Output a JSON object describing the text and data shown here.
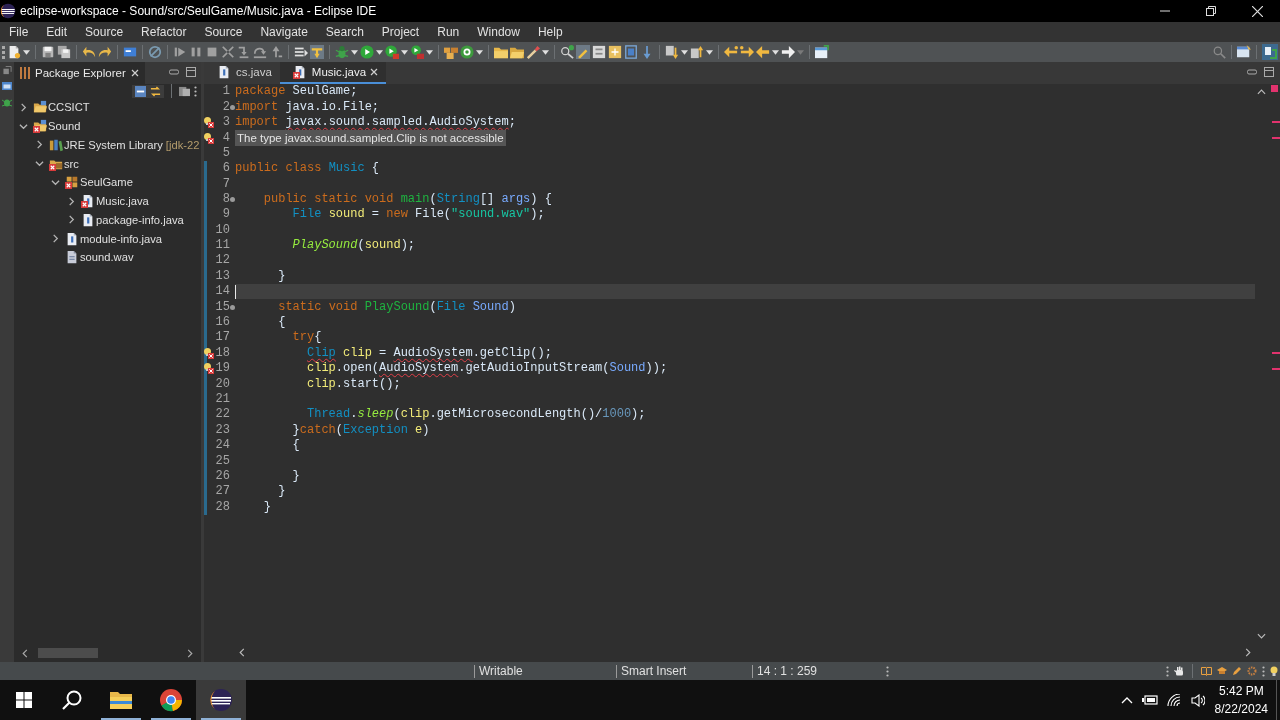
{
  "window": {
    "title": "eclipse-workspace - Sound/src/SeulGame/Music.java - Eclipse IDE"
  },
  "menu": [
    "File",
    "Edit",
    "Source",
    "Refactor",
    "Source",
    "Navigate",
    "Search",
    "Project",
    "Run",
    "Window",
    "Help"
  ],
  "package_explorer": {
    "title": "Package Explorer",
    "tree": [
      {
        "label": "CCSICT",
        "kind": "project",
        "expanded": false,
        "error": false
      },
      {
        "label": "Sound",
        "kind": "project",
        "expanded": true,
        "error": true,
        "children": [
          {
            "label": "JRE System Library",
            "decoration": "[jdk-22",
            "kind": "library",
            "expanded": false,
            "error": false
          },
          {
            "label": "src",
            "kind": "source_folder",
            "expanded": true,
            "error": true,
            "children": [
              {
                "label": "SeulGame",
                "kind": "package",
                "expanded": true,
                "error": true,
                "children": [
                  {
                    "label": "Music.java",
                    "kind": "java_file",
                    "expanded": false,
                    "error": true
                  },
                  {
                    "label": "package-info.java",
                    "kind": "java_file",
                    "expanded": false,
                    "error": false
                  }
                ]
              },
              {
                "label": "module-info.java",
                "kind": "java_file",
                "expanded": false,
                "error": false
              },
              {
                "label": "sound.wav",
                "kind": "file",
                "error": false
              }
            ]
          }
        ]
      }
    ]
  },
  "editor": {
    "tabs": [
      {
        "label": "cs.java",
        "selected": false,
        "error": false
      },
      {
        "label": "Music.java",
        "selected": true,
        "error": true
      }
    ],
    "lines": [
      {
        "number": "1",
        "current": false,
        "scope": false,
        "error": false,
        "foldable": false,
        "tokens": [
          {
            "text": "package",
            "kind": "keyword",
            "error": false
          },
          {
            "text": " SeulGame;",
            "kind": "plain",
            "error": false
          }
        ]
      },
      {
        "number": "2",
        "current": false,
        "scope": false,
        "error": false,
        "foldable": true,
        "tokens": [
          {
            "text": "import",
            "kind": "keyword",
            "error": false
          },
          {
            "text": " java.io.File;",
            "kind": "plain",
            "error": false
          }
        ]
      },
      {
        "number": "3",
        "current": false,
        "scope": false,
        "error": true,
        "foldable": false,
        "tokens": [
          {
            "text": "import ",
            "kind": "keyword",
            "error": false
          },
          {
            "text": "javax.sound.sampled.AudioSystem",
            "kind": "plain",
            "error": true
          },
          {
            "text": ";",
            "kind": "plain",
            "error": false
          }
        ]
      },
      {
        "number": "4",
        "current": false,
        "scope": false,
        "error": true,
        "foldable": false,
        "tooltip": "The type javax.sound.sampled.Clip is not accessible"
      },
      {
        "number": "5",
        "current": false,
        "scope": false,
        "error": false,
        "foldable": false
      },
      {
        "number": "6",
        "current": false,
        "scope": true,
        "error": false,
        "foldable": false,
        "tokens": [
          {
            "text": "public class ",
            "kind": "keyword",
            "error": false
          },
          {
            "text": "Music",
            "kind": "type",
            "error": false
          },
          {
            "text": " {",
            "kind": "plain",
            "error": false
          }
        ]
      },
      {
        "number": "7",
        "current": false,
        "scope": true,
        "error": false,
        "foldable": false
      },
      {
        "number": "8",
        "current": false,
        "scope": true,
        "error": false,
        "foldable": true,
        "tokens": [
          {
            "text": "    public static void ",
            "kind": "keyword",
            "error": false
          },
          {
            "text": "main",
            "kind": "method_declaration",
            "error": false
          },
          {
            "text": "(",
            "kind": "plain",
            "error": false
          },
          {
            "text": "String",
            "kind": "type",
            "error": false
          },
          {
            "text": "[] ",
            "kind": "plain",
            "error": false
          },
          {
            "text": "args",
            "kind": "parameter",
            "error": false
          },
          {
            "text": ") {",
            "kind": "plain",
            "error": false
          }
        ]
      },
      {
        "number": "9",
        "current": false,
        "scope": true,
        "error": false,
        "foldable": false,
        "tokens": [
          {
            "text": "        File ",
            "kind": "type",
            "error": false
          },
          {
            "text": "sound",
            "kind": "local",
            "error": false
          },
          {
            "text": " = ",
            "kind": "plain",
            "error": false
          },
          {
            "text": "new",
            "kind": "keyword",
            "error": false
          },
          {
            "text": " File(",
            "kind": "plain",
            "error": false
          },
          {
            "text": "\"sound.wav\"",
            "kind": "string",
            "error": false
          },
          {
            "text": ");",
            "kind": "plain",
            "error": false
          }
        ]
      },
      {
        "number": "10",
        "current": false,
        "scope": true,
        "error": false,
        "foldable": false
      },
      {
        "number": "11",
        "current": false,
        "scope": true,
        "error": false,
        "foldable": false,
        "tokens": [
          {
            "text": "        PlaySound",
            "kind": "static_call",
            "error": false
          },
          {
            "text": "(",
            "kind": "plain",
            "error": false
          },
          {
            "text": "sound",
            "kind": "local",
            "error": false
          },
          {
            "text": ");",
            "kind": "plain",
            "error": false
          }
        ]
      },
      {
        "number": "12",
        "current": false,
        "scope": true,
        "error": false,
        "foldable": false
      },
      {
        "number": "13",
        "current": false,
        "scope": true,
        "error": false,
        "foldable": false,
        "tokens": [
          {
            "text": "      }",
            "kind": "plain",
            "error": false
          }
        ]
      },
      {
        "number": "14",
        "current": true,
        "scope": true,
        "error": false,
        "foldable": false
      },
      {
        "number": "15",
        "current": false,
        "scope": true,
        "error": false,
        "foldable": true,
        "tokens": [
          {
            "text": "      static void ",
            "kind": "keyword",
            "error": false
          },
          {
            "text": "PlaySound",
            "kind": "method_declaration",
            "error": false
          },
          {
            "text": "(",
            "kind": "plain",
            "error": false
          },
          {
            "text": "File ",
            "kind": "type",
            "error": false
          },
          {
            "text": "Sound",
            "kind": "parameter",
            "error": false
          },
          {
            "text": ")",
            "kind": "plain",
            "error": false
          }
        ]
      },
      {
        "number": "16",
        "current": false,
        "scope": true,
        "error": false,
        "foldable": false,
        "tokens": [
          {
            "text": "      {",
            "kind": "plain",
            "error": false
          }
        ]
      },
      {
        "number": "17",
        "current": false,
        "scope": true,
        "error": false,
        "foldable": false,
        "tokens": [
          {
            "text": "        try",
            "kind": "keyword",
            "error": false
          },
          {
            "text": "{",
            "kind": "plain",
            "error": false
          }
        ]
      },
      {
        "number": "18",
        "current": false,
        "scope": true,
        "error": true,
        "foldable": false,
        "tokens": [
          {
            "text": "          Clip",
            "kind": "type",
            "error": true
          },
          {
            "text": " clip",
            "kind": "local",
            "error": false
          },
          {
            "text": " = ",
            "kind": "plain",
            "error": false
          },
          {
            "text": "AudioSystem",
            "kind": "plain",
            "error": true
          },
          {
            "text": ".getClip();",
            "kind": "plain",
            "error": false
          }
        ]
      },
      {
        "number": "19",
        "current": false,
        "scope": true,
        "error": true,
        "foldable": false,
        "tokens": [
          {
            "text": "          clip",
            "kind": "local",
            "error": false
          },
          {
            "text": ".open(",
            "kind": "plain",
            "error": false
          },
          {
            "text": "AudioSystem",
            "kind": "plain",
            "error": true
          },
          {
            "text": ".getAudioInputStream(",
            "kind": "plain",
            "error": false
          },
          {
            "text": "Sound",
            "kind": "parameter",
            "error": false
          },
          {
            "text": "));",
            "kind": "plain",
            "error": false
          }
        ]
      },
      {
        "number": "20",
        "current": false,
        "scope": true,
        "error": false,
        "foldable": false,
        "tokens": [
          {
            "text": "          clip",
            "kind": "local",
            "error": false
          },
          {
            "text": ".start();",
            "kind": "plain",
            "error": false
          }
        ]
      },
      {
        "number": "21",
        "current": false,
        "scope": true,
        "error": false,
        "foldable": false
      },
      {
        "number": "22",
        "current": false,
        "scope": true,
        "error": false,
        "foldable": false,
        "tokens": [
          {
            "text": "          Thread",
            "kind": "type",
            "error": false
          },
          {
            "text": ".",
            "kind": "plain",
            "error": false
          },
          {
            "text": "sleep",
            "kind": "static_call",
            "error": false
          },
          {
            "text": "(",
            "kind": "plain",
            "error": false
          },
          {
            "text": "clip",
            "kind": "local",
            "error": false
          },
          {
            "text": ".getMicrosecondLength()/",
            "kind": "plain",
            "error": false
          },
          {
            "text": "1000",
            "kind": "number",
            "error": false
          },
          {
            "text": ");",
            "kind": "plain",
            "error": false
          }
        ]
      },
      {
        "number": "23",
        "current": false,
        "scope": true,
        "error": false,
        "foldable": false,
        "tokens": [
          {
            "text": "        }",
            "kind": "plain",
            "error": false
          },
          {
            "text": "catch",
            "kind": "keyword",
            "error": false
          },
          {
            "text": "(",
            "kind": "plain",
            "error": false
          },
          {
            "text": "Exception ",
            "kind": "type",
            "error": false
          },
          {
            "text": "e",
            "kind": "local",
            "error": false
          },
          {
            "text": ")",
            "kind": "plain",
            "error": false
          }
        ]
      },
      {
        "number": "24",
        "current": false,
        "scope": true,
        "error": false,
        "foldable": false,
        "tokens": [
          {
            "text": "        {",
            "kind": "plain",
            "error": false
          }
        ]
      },
      {
        "number": "25",
        "current": false,
        "scope": true,
        "error": false,
        "foldable": false
      },
      {
        "number": "26",
        "current": false,
        "scope": true,
        "error": false,
        "foldable": false,
        "tokens": [
          {
            "text": "        }",
            "kind": "plain",
            "error": false
          }
        ]
      },
      {
        "number": "27",
        "current": false,
        "scope": true,
        "error": false,
        "foldable": false,
        "tokens": [
          {
            "text": "      }",
            "kind": "plain",
            "error": false
          }
        ]
      },
      {
        "number": "28",
        "current": false,
        "scope": true,
        "error": false,
        "foldable": false,
        "tokens": [
          {
            "text": "    }",
            "kind": "plain",
            "error": false
          }
        ]
      }
    ]
  },
  "status_bar": {
    "mode": "Writable",
    "insert_mode": "Smart Insert",
    "position": "14 : 1 : 259"
  },
  "taskbar": {
    "apps": [
      {
        "kind": "file_manager",
        "active": false
      },
      {
        "kind": "browser",
        "active": false
      },
      {
        "kind": "ide",
        "active": true
      }
    ],
    "clock": {
      "time": "5:42 PM",
      "date": "8/22/2024"
    }
  }
}
